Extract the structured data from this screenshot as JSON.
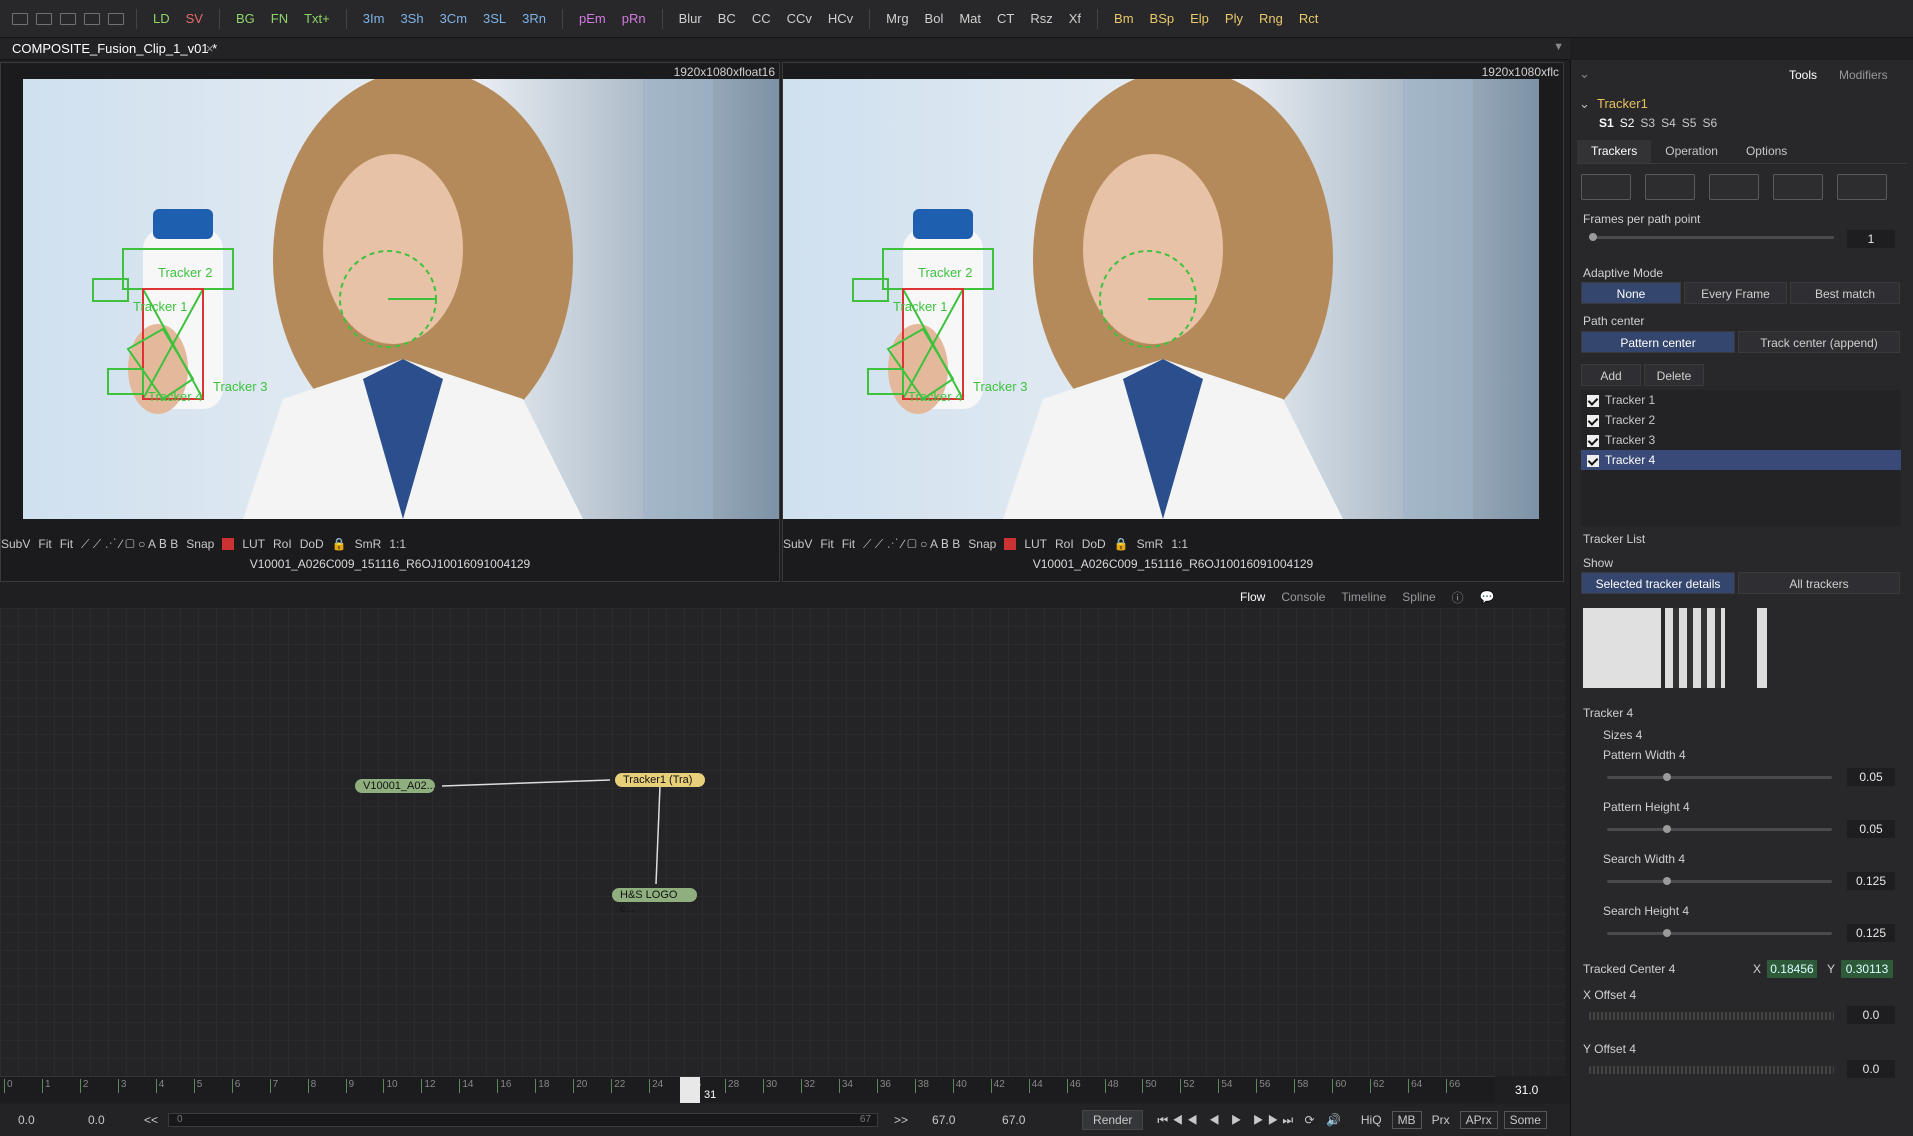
{
  "toolbar": {
    "items": [
      {
        "label": "LD",
        "color": "#8fd36b"
      },
      {
        "label": "SV",
        "color": "#e26b6b"
      },
      {
        "label": "BG",
        "color": "#8fd36b"
      },
      {
        "label": "FN",
        "color": "#8fd36b"
      },
      {
        "label": "Txt+",
        "color": "#8fd36b"
      },
      {
        "label": "3Im",
        "color": "#7fb3e8"
      },
      {
        "label": "3Sh",
        "color": "#7fb3e8"
      },
      {
        "label": "3Cm",
        "color": "#7fb3e8"
      },
      {
        "label": "3SL",
        "color": "#7fb3e8"
      },
      {
        "label": "3Rn",
        "color": "#7fb3e8"
      },
      {
        "label": "pEm",
        "color": "#d17be0"
      },
      {
        "label": "pRn",
        "color": "#d17be0"
      },
      {
        "label": "Blur",
        "color": "#d0d0d0"
      },
      {
        "label": "BC",
        "color": "#d0d0d0"
      },
      {
        "label": "CC",
        "color": "#d0d0d0"
      },
      {
        "label": "CCv",
        "color": "#d0d0d0"
      },
      {
        "label": "HCv",
        "color": "#d0d0d0"
      },
      {
        "label": "Mrg",
        "color": "#d0d0d0"
      },
      {
        "label": "Bol",
        "color": "#d0d0d0"
      },
      {
        "label": "Mat",
        "color": "#d0d0d0"
      },
      {
        "label": "CT",
        "color": "#d0d0d0"
      },
      {
        "label": "Rsz",
        "color": "#d0d0d0"
      },
      {
        "label": "Xf",
        "color": "#d0d0d0"
      },
      {
        "label": "Bm",
        "color": "#e8c96b"
      },
      {
        "label": "BSp",
        "color": "#e8c96b"
      },
      {
        "label": "Elp",
        "color": "#e8c96b"
      },
      {
        "label": "Ply",
        "color": "#e8c96b"
      },
      {
        "label": "Rng",
        "color": "#e8c96b"
      },
      {
        "label": "Rct",
        "color": "#e8c96b"
      }
    ]
  },
  "doc_tab": {
    "title": "COMPOSITE_Fusion_Clip_1_v01 *",
    "close": "×"
  },
  "viewer_left": {
    "res": "1920x1080xfloat16",
    "clip": "V10001_A026C009_151116_R6OJ10016091004129",
    "bar": [
      "SubV",
      "Fit",
      "Fit",
      "Snap",
      "LUT",
      "RoI",
      "DoD",
      "SmR",
      "1:1"
    ]
  },
  "viewer_right": {
    "res": "1920x1080xflc",
    "clip": "V10001_A026C009_151116_R6OJ10016091004129",
    "bar": [
      "SubV",
      "Fit",
      "Fit",
      "Snap",
      "LUT",
      "RoI",
      "DoD",
      "SmR",
      "1:1"
    ]
  },
  "tracker_labels": [
    "Tracker 2",
    "Tracker 1",
    "Tracker 4",
    "Tracker 3"
  ],
  "flow_tabs": [
    "Flow",
    "Console",
    "Timeline",
    "Spline"
  ],
  "nodes": {
    "loader": "V10001_A02...",
    "tracker": "Tracker1 (Tra)",
    "logo": "H&S LOGO c..."
  },
  "ruler": {
    "ticks": [
      "0",
      "1",
      "2",
      "3",
      "4",
      "5",
      "6",
      "7",
      "8",
      "9",
      "10",
      "12",
      "14",
      "16",
      "18",
      "20",
      "22",
      "24",
      "26",
      "28",
      "30",
      "32",
      "34",
      "36",
      "38",
      "40",
      "42",
      "44",
      "46",
      "48",
      "50",
      "52",
      "54",
      "56",
      "58",
      "60",
      "62",
      "64",
      "66"
    ],
    "current": "31",
    "current_value": "31.0"
  },
  "transport": {
    "start": "0.0",
    "render_start": "0.0",
    "rewind": "<<",
    "range_start": "0",
    "range_end": "67",
    "ff": ">>",
    "render_end": "67.0",
    "end": "67.0",
    "render": "Render",
    "hiq": "HiQ",
    "mb": "MB",
    "prx": "Prx",
    "aprx": "APrx",
    "some": "Some"
  },
  "panel": {
    "tabs": [
      "Tools",
      "Modifiers"
    ],
    "tool_name": "Tracker1",
    "slots": [
      "S1",
      "S2",
      "S3",
      "S4",
      "S5",
      "S6"
    ],
    "subtabs": [
      "Trackers",
      "Operation",
      "Options"
    ],
    "frames_label": "Frames per path point",
    "frames_value": "1",
    "adaptive_label": "Adaptive Mode",
    "adaptive": [
      "None",
      "Every Frame",
      "Best match"
    ],
    "path_label": "Path center",
    "path": [
      "Pattern center",
      "Track center (append)"
    ],
    "add": "Add",
    "delete": "Delete",
    "trackers": [
      "Tracker 1",
      "Tracker 2",
      "Tracker 3",
      "Tracker 4"
    ],
    "tracker_list": "Tracker List",
    "show": "Show",
    "show_opts": [
      "Selected tracker details",
      "All trackers"
    ],
    "tracker4": "Tracker 4",
    "sizes": "Sizes 4",
    "params": [
      {
        "label": "Pattern Width 4",
        "value": "0.05",
        "pos": 0.25
      },
      {
        "label": "Pattern Height 4",
        "value": "0.05",
        "pos": 0.25
      },
      {
        "label": "Search Width 4",
        "value": "0.125",
        "pos": 0.25
      },
      {
        "label": "Search Height 4",
        "value": "0.125",
        "pos": 0.25
      }
    ],
    "tracked_center": "Tracked Center 4",
    "x_label": "X",
    "x_value": "0.18456",
    "y_label": "Y",
    "y_value": "0.30113",
    "x_offset": "X Offset 4",
    "x_offset_value": "0.0",
    "y_offset": "Y Offset 4",
    "y_offset_value": "0.0"
  }
}
